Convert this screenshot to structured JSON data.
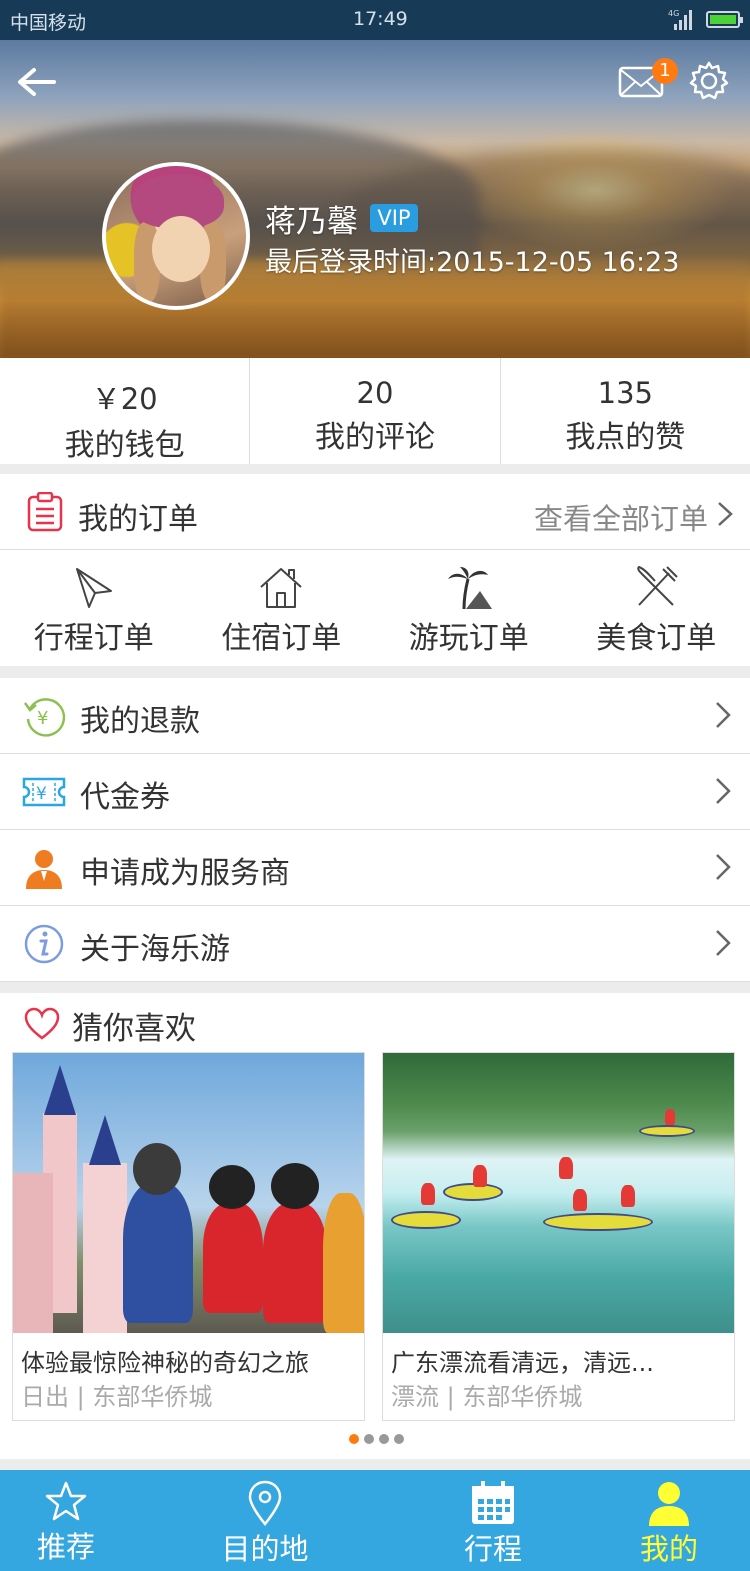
{
  "status_bar": {
    "carrier": "中国移动",
    "time": "17:49",
    "network": "4G"
  },
  "profile": {
    "name": "蒋乃馨",
    "badge": "VIP",
    "last_login": "最后登录时间:2015-12-05 16:23",
    "unread_messages": "1"
  },
  "stats": [
    {
      "value": "￥20",
      "label": "我的钱包"
    },
    {
      "value": "20",
      "label": "我的评论"
    },
    {
      "value": "135",
      "label": "我点的赞"
    }
  ],
  "orders": {
    "title": "我的订单",
    "view_all": "查看全部订单",
    "types": [
      {
        "label": "行程订单",
        "icon": "paper-plane-icon"
      },
      {
        "label": "住宿订单",
        "icon": "house-icon"
      },
      {
        "label": "游玩订单",
        "icon": "palm-tree-icon"
      },
      {
        "label": "美食订单",
        "icon": "fork-knife-icon"
      }
    ]
  },
  "menu": [
    {
      "label": "我的退款",
      "icon": "refund-icon"
    },
    {
      "label": "代金券",
      "icon": "voucher-icon"
    },
    {
      "label": "申请成为服务商",
      "icon": "service-provider-icon"
    },
    {
      "label": "关于海乐游",
      "icon": "info-icon"
    }
  ],
  "recommendations": {
    "title": "猜你喜欢",
    "items": [
      {
        "title": "体验最惊险神秘的奇幻之旅",
        "subtitle": "日出 | 东部华侨城"
      },
      {
        "title": "广东漂流看清远，清远...",
        "subtitle": "漂流 | 东部华侨城"
      }
    ],
    "page_count": 4,
    "active_page": 1
  },
  "tabbar": {
    "tabs": [
      {
        "label": "推荐",
        "icon": "star-icon"
      },
      {
        "label": "目的地",
        "icon": "location-pin-icon"
      },
      {
        "label": "行程",
        "icon": "calendar-icon"
      },
      {
        "label": "我的",
        "icon": "person-icon"
      }
    ],
    "active": "我的",
    "active_color": "#ffff33",
    "bar_color": "#34a6e0"
  },
  "colors": {
    "accent_orange": "#ff7a10",
    "vip_blue": "#2a9de0",
    "status_bar": "#173b57"
  }
}
